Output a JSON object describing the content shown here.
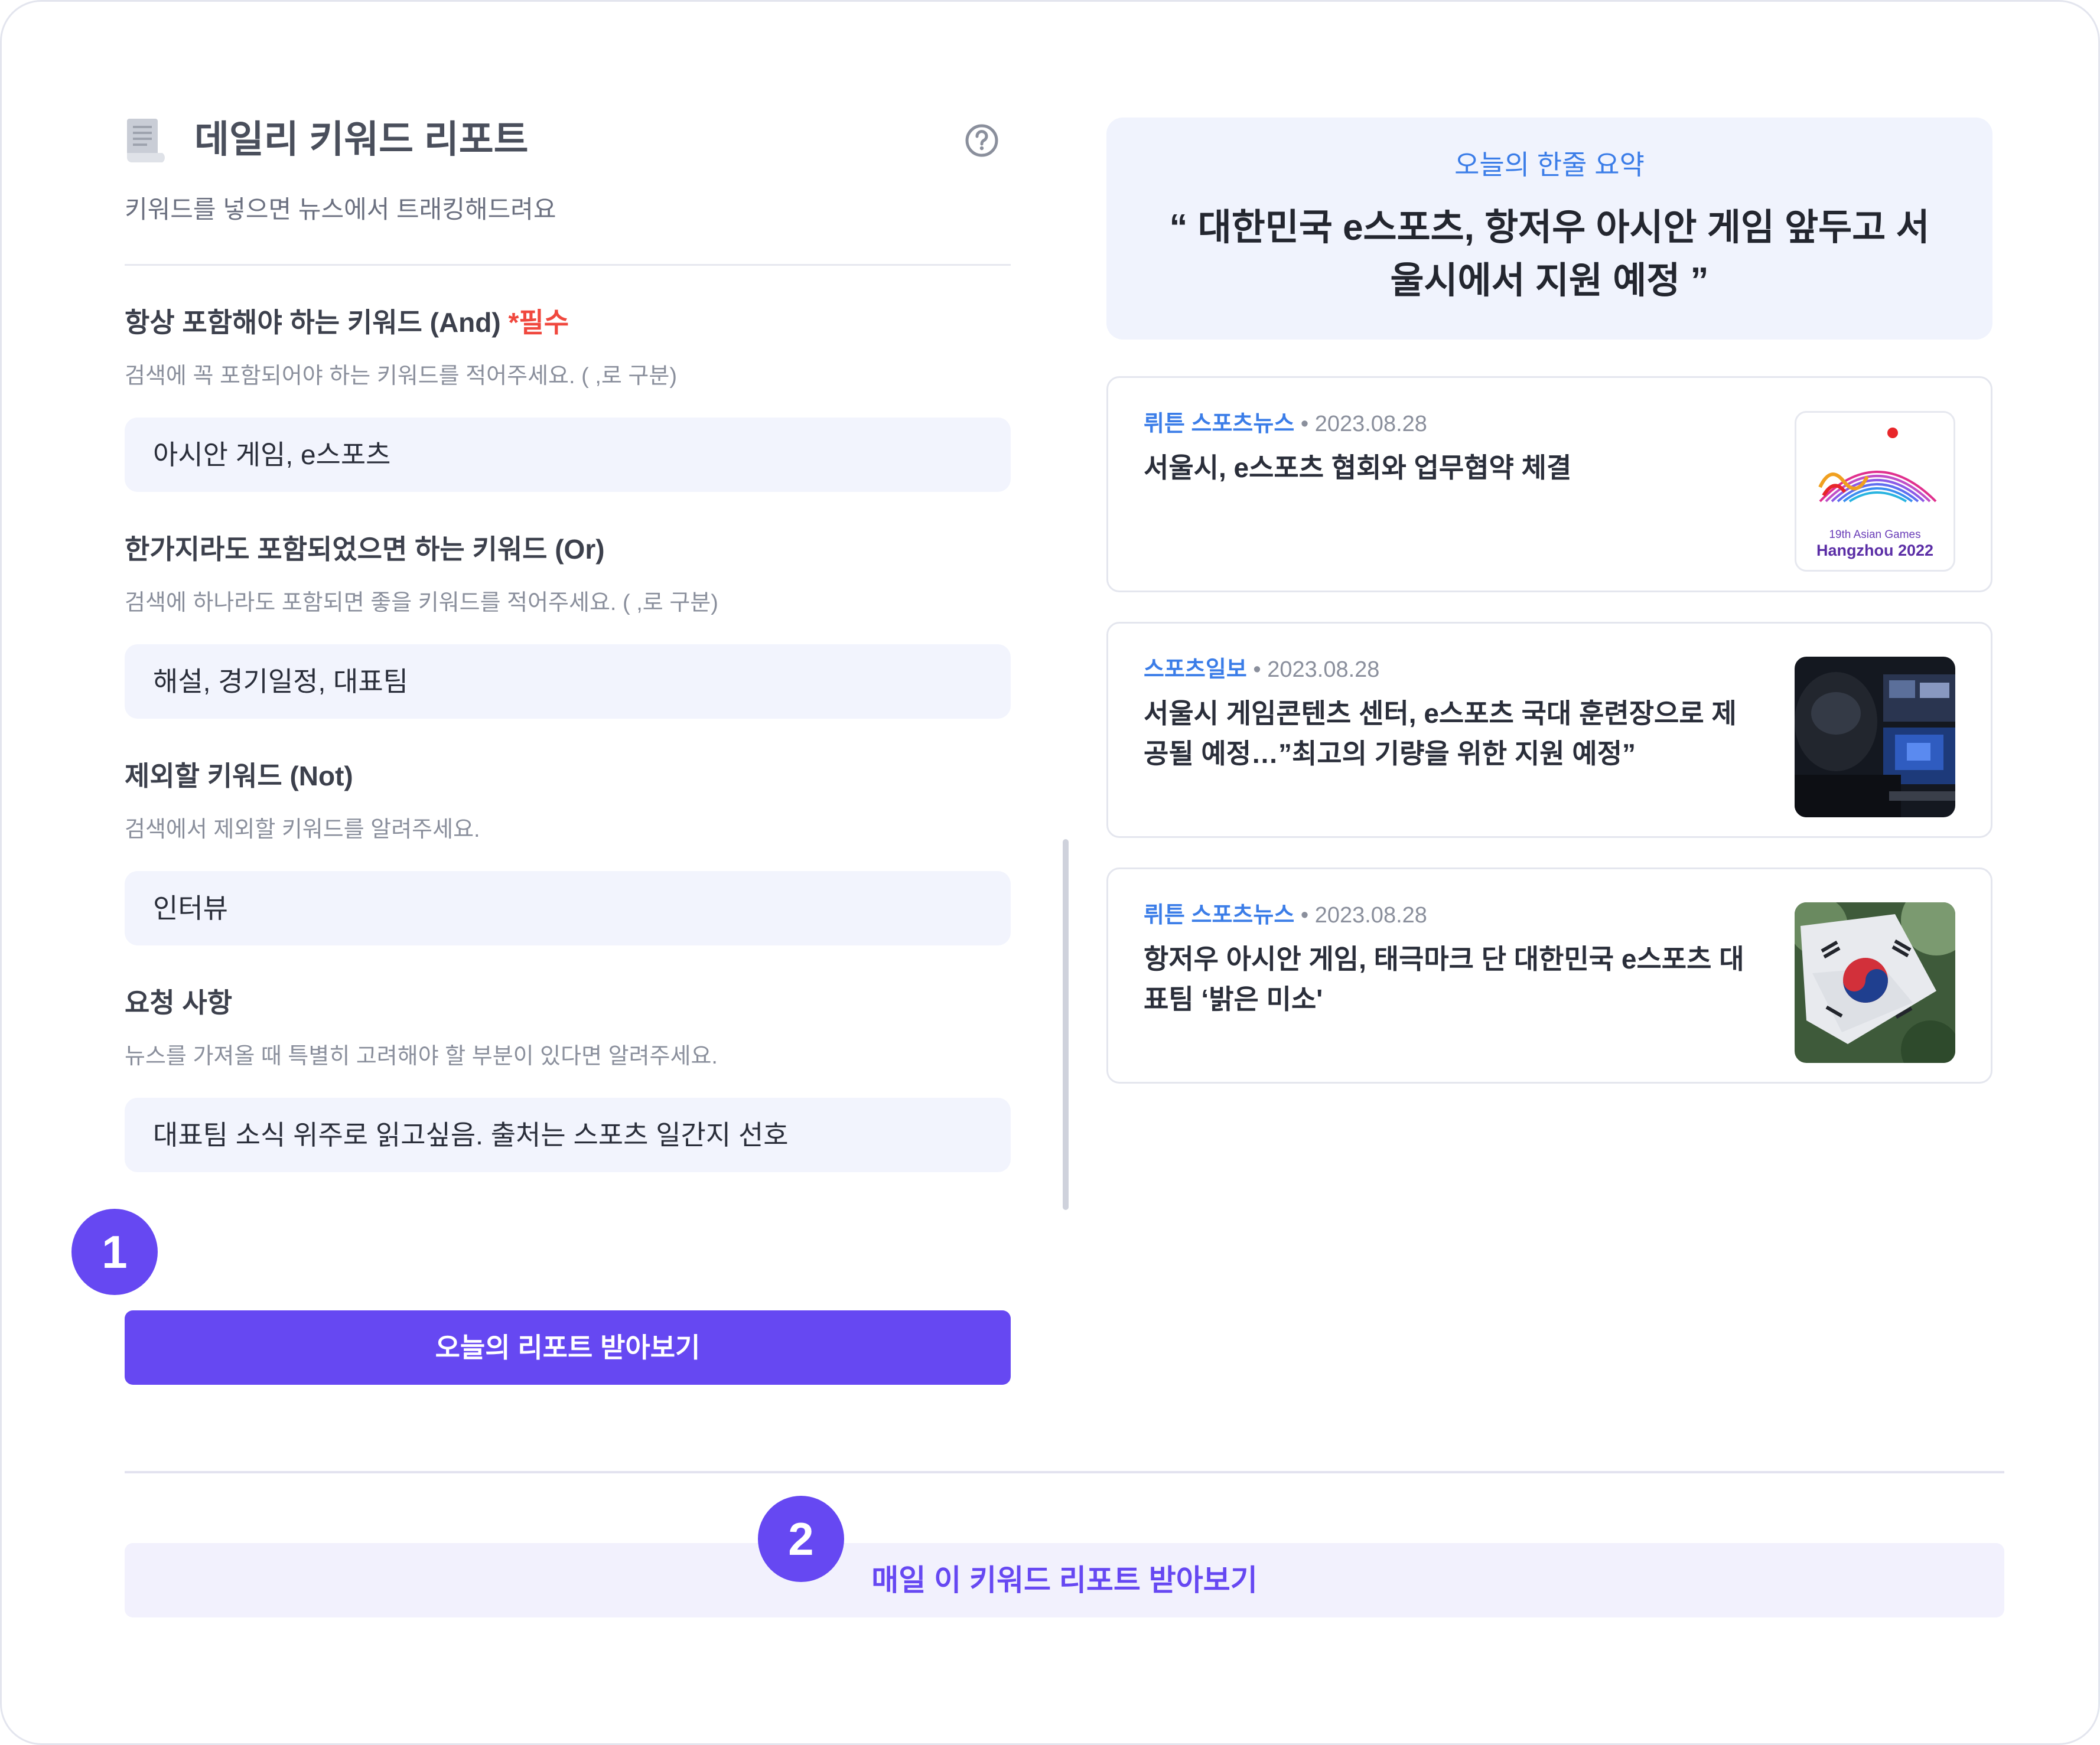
{
  "header": {
    "title": "데일리 키워드 리포트",
    "subtitle": "키워드를 넣으면 뉴스에서 트래킹해드려요"
  },
  "fields": [
    {
      "label": "항상 포함해야 하는 키워드 (And)",
      "required_mark": "*필수",
      "hint": "검색에 꼭 포함되어야 하는 키워드를 적어주세요. ( ,로 구분)",
      "value": "아시안 게임, e스포츠"
    },
    {
      "label": "한가지라도 포함되었으면 하는 키워드 (Or)",
      "hint": "검색에 하나라도 포함되면 좋을 키워드를 적어주세요. ( ,로 구분)",
      "value": "해설, 경기일정, 대표팀"
    },
    {
      "label": "제외할 키워드 (Not)",
      "hint": "검색에서 제외할 키워드를 알려주세요.",
      "value": "인터뷰"
    },
    {
      "label": "요청 사항",
      "hint": "뉴스를 가져올 때 특별히 고려해야 할 부분이 있다면 알려주세요.",
      "value": "대표팀 소식 위주로 읽고싶음. 출처는 스포츠 일간지 선호"
    }
  ],
  "badges": {
    "first": "1",
    "second": "2"
  },
  "actions": {
    "today_report": "오늘의 리포트 받아보기",
    "daily_report": "매일 이 키워드 리포트 받아보기"
  },
  "summary": {
    "label": "오늘의 한줄 요약",
    "quote": "“ 대한민국 e스포츠, 항저우 아시안 게임 앞두고 서울시에서 지원 예정 ”"
  },
  "news": [
    {
      "source": "뤼튼 스포츠뉴스",
      "date": "2023.08.28",
      "headline": "서울시, e스포츠 협회와 업무협약 체결",
      "thumb_caption_1": "19th Asian Games",
      "thumb_caption_2": "Hangzhou 2022"
    },
    {
      "source": "스포츠일보",
      "date": "2023.08.28",
      "headline": "서울시 게임콘텐츠 센터, e스포츠 국대 훈련장으로 제공될 예정…”최고의 기량을 위한 지원 예정”"
    },
    {
      "source": "뤼튼 스포츠뉴스",
      "date": "2023.08.28",
      "headline": "항저우 아시안 게임, 태극마크 단 대한민국 e스포츠 대표팀 ‘밝은 미소'"
    }
  ],
  "colors": {
    "accent": "#6648f2",
    "link": "#3b7de8",
    "required": "#f0483e",
    "input_bg": "#f2f4fd"
  }
}
